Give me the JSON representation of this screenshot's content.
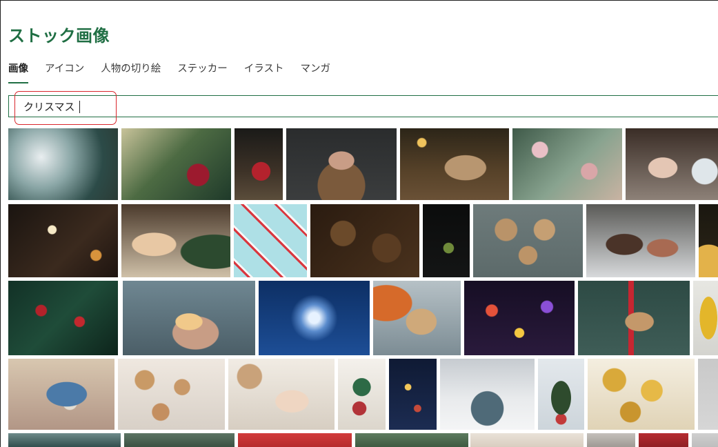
{
  "page": {
    "title": "ストック画像"
  },
  "tabs": [
    {
      "label": "画像",
      "active": true
    },
    {
      "label": "アイコン",
      "active": false
    },
    {
      "label": "人物の切り絵",
      "active": false
    },
    {
      "label": "ステッカー",
      "active": false
    },
    {
      "label": "イラスト",
      "active": false
    },
    {
      "label": "マンガ",
      "active": false
    }
  ],
  "search": {
    "value": "クリスマス"
  },
  "colors": {
    "accent": "#1f6e43",
    "highlight": "#d9262b"
  },
  "results": [
    {
      "name": "ornaments-pinecones-photo"
    },
    {
      "name": "red-bauble-branch-photo"
    },
    {
      "name": "red-gift-box-lights-photo"
    },
    {
      "name": "woman-novelty-glasses-photo"
    },
    {
      "name": "kraft-gift-on-table-photo"
    },
    {
      "name": "decorated-tree-closeup-photo"
    },
    {
      "name": "woman-snow-globe-photo"
    },
    {
      "name": "sparkler-photo"
    },
    {
      "name": "kids-decorating-tree-photo"
    },
    {
      "name": "candy-canes-pattern-photo"
    },
    {
      "name": "pinecones-closeup-photo"
    },
    {
      "name": "hanging-mistletoe-photo"
    },
    {
      "name": "wrapped-gifts-flatlay-photo"
    },
    {
      "name": "man-carrying-presents-photo"
    },
    {
      "name": "golden-bokeh-photo"
    },
    {
      "name": "holly-berries-photo"
    },
    {
      "name": "hands-fairy-lights-photo"
    },
    {
      "name": "snowflake-blue-photo"
    },
    {
      "name": "hands-gift-sweater-photo"
    },
    {
      "name": "colorful-bokeh-photo"
    },
    {
      "name": "gift-red-ribbon-photo"
    },
    {
      "name": "yellow-sweater-photo"
    },
    {
      "name": "woman-holding-gift-photo"
    },
    {
      "name": "advent-calendar-bags-photo"
    },
    {
      "name": "advent-calendar-boxes-photo"
    },
    {
      "name": "paper-ornaments-photo"
    },
    {
      "name": "lit-tree-night-photo"
    },
    {
      "name": "truck-snow-tree-photo"
    },
    {
      "name": "outdoor-tree-snow-photo"
    },
    {
      "name": "gold-baubles-pile-photo"
    },
    {
      "name": "gray-tile-photo"
    },
    {
      "name": "bottom-row-photo-1"
    },
    {
      "name": "bottom-row-photo-2"
    },
    {
      "name": "bottom-row-photo-3"
    },
    {
      "name": "bottom-row-photo-4"
    },
    {
      "name": "bottom-row-photo-5"
    },
    {
      "name": "bottom-row-photo-6"
    },
    {
      "name": "bottom-row-photo-7"
    },
    {
      "name": "bottom-row-photo-8"
    },
    {
      "name": "bottom-row-photo-9"
    }
  ]
}
